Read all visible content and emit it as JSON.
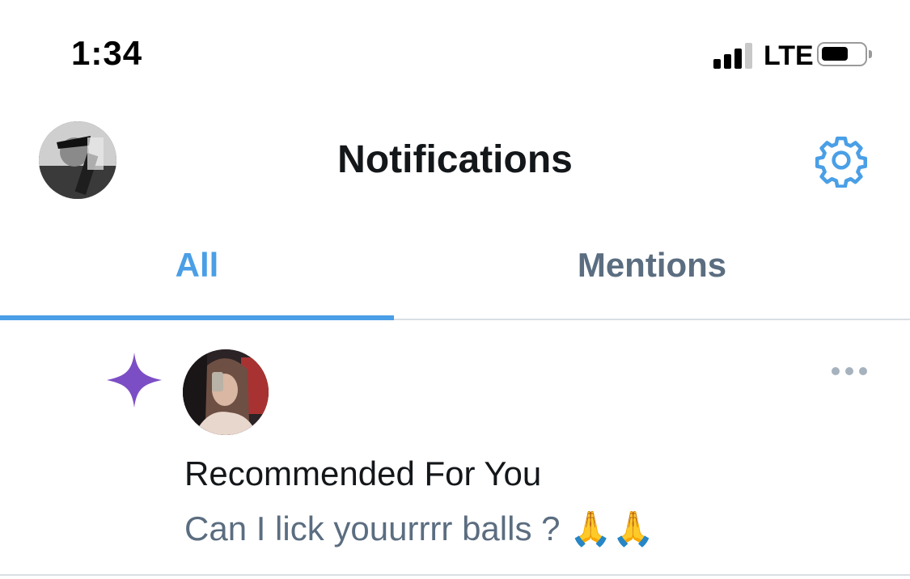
{
  "status_bar": {
    "time": "1:34",
    "network": "LTE",
    "signal_bars": 3,
    "signal_bars_total": 4,
    "battery_level": 0.6
  },
  "header": {
    "title": "Notifications",
    "avatar_icon": "profile-avatar",
    "settings_icon": "gear-icon"
  },
  "tabs": [
    {
      "label": "All",
      "active": true
    },
    {
      "label": "Mentions",
      "active": false
    }
  ],
  "notification": {
    "icon": "sparkle-icon",
    "heading": "Recommended For You",
    "text": "Can I lick youurrrr balls ? 🙏🙏",
    "menu_icon": "more-icon"
  },
  "colors": {
    "accent": "#4a9fe6",
    "muted_text": "#5b6d80",
    "sparkle": "#7c4ec5",
    "divider": "#d9dfe4"
  }
}
